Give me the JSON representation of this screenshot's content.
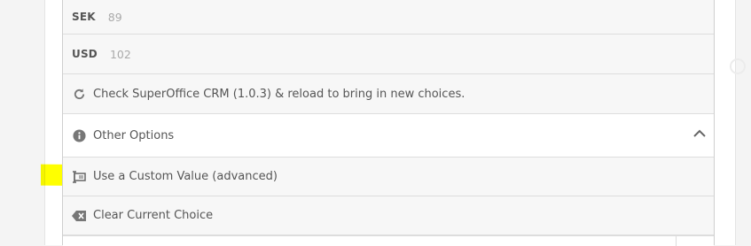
{
  "options": [
    {
      "code": "SEK",
      "value": "89"
    },
    {
      "code": "USD",
      "value": "102"
    }
  ],
  "reload_text": "Check SuperOffice CRM (1.0.3) & reload to bring in new choices.",
  "other_options": {
    "label": "Other Options",
    "expanded": true
  },
  "custom_value_label": "Use a Custom Value (advanced)",
  "clear_choice_label": "Clear Current Choice",
  "colors": {
    "highlight": "#ffff00",
    "text": "#555555",
    "muted": "#aaaaaa"
  }
}
